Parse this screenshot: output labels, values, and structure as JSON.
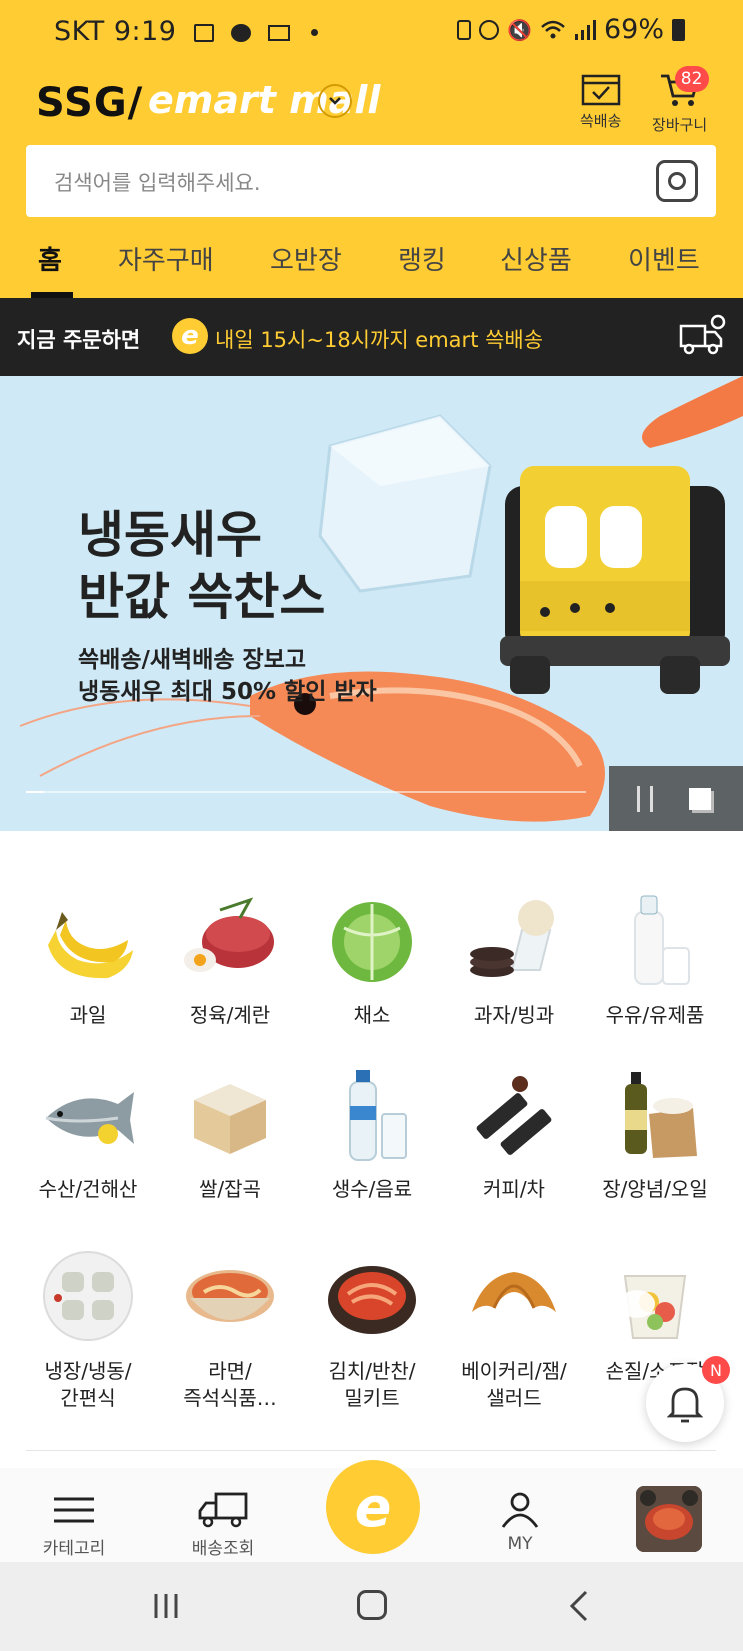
{
  "status_bar": {
    "carrier": "SKT",
    "time": "9:19",
    "battery": "69%"
  },
  "header": {
    "logo_ssg": "SSG/",
    "logo_emart": "emart mall",
    "ssgdelivery_label": "쓱배송",
    "cart_label": "장바구니",
    "cart_count": "82",
    "brand_color": "#FFCC33"
  },
  "search": {
    "placeholder": "검색어를 입력해주세요."
  },
  "tabs": [
    {
      "label": "홈",
      "active": true
    },
    {
      "label": "자주구매"
    },
    {
      "label": "오반장"
    },
    {
      "label": "랭킹"
    },
    {
      "label": "신상품"
    },
    {
      "label": "이벤트"
    }
  ],
  "delivery_bar": {
    "lead": "지금 주문하면",
    "message": "내일 15시~18시까지 emart 쓱배송",
    "badge": "e"
  },
  "promo": {
    "title_line1": "냉동새우",
    "title_line2": "반값 쓱찬스",
    "sub_line1": "쓱배송/새벽배송 장보고",
    "sub_line2": "냉동새우 최대 50% 할인 받자"
  },
  "categories": [
    {
      "label": "과일",
      "icon": "banana-icon"
    },
    {
      "label": "정육/계란",
      "icon": "steak-egg-icon"
    },
    {
      "label": "채소",
      "icon": "cabbage-icon"
    },
    {
      "label": "과자/빙과",
      "icon": "cookie-icecream-icon"
    },
    {
      "label": "우유/유제품",
      "icon": "milk-icon"
    },
    {
      "label": "수산/건해산",
      "icon": "fish-icon"
    },
    {
      "label": "쌀/잡곡",
      "icon": "rice-box-icon"
    },
    {
      "label": "생수/음료",
      "icon": "water-bottle-icon"
    },
    {
      "label": "커피/차",
      "icon": "coffee-stick-icon"
    },
    {
      "label": "장/양념/오일",
      "icon": "oil-bottle-icon"
    },
    {
      "label": "냉장/냉동/\n간편식",
      "icon": "dumpling-icon"
    },
    {
      "label": "라면/\n즉석식품…",
      "icon": "ramen-icon"
    },
    {
      "label": "김치/반찬/\n밀키트",
      "icon": "kimchi-icon"
    },
    {
      "label": "베이커리/잼/\n샐러드",
      "icon": "croissant-icon"
    },
    {
      "label": "손질/소포장",
      "icon": "fruit-cup-icon"
    }
  ],
  "notification": {
    "badge": "N"
  },
  "bottom_nav": {
    "category": "카테고리",
    "tracking": "배송조회",
    "center": "e",
    "my": "MY"
  }
}
